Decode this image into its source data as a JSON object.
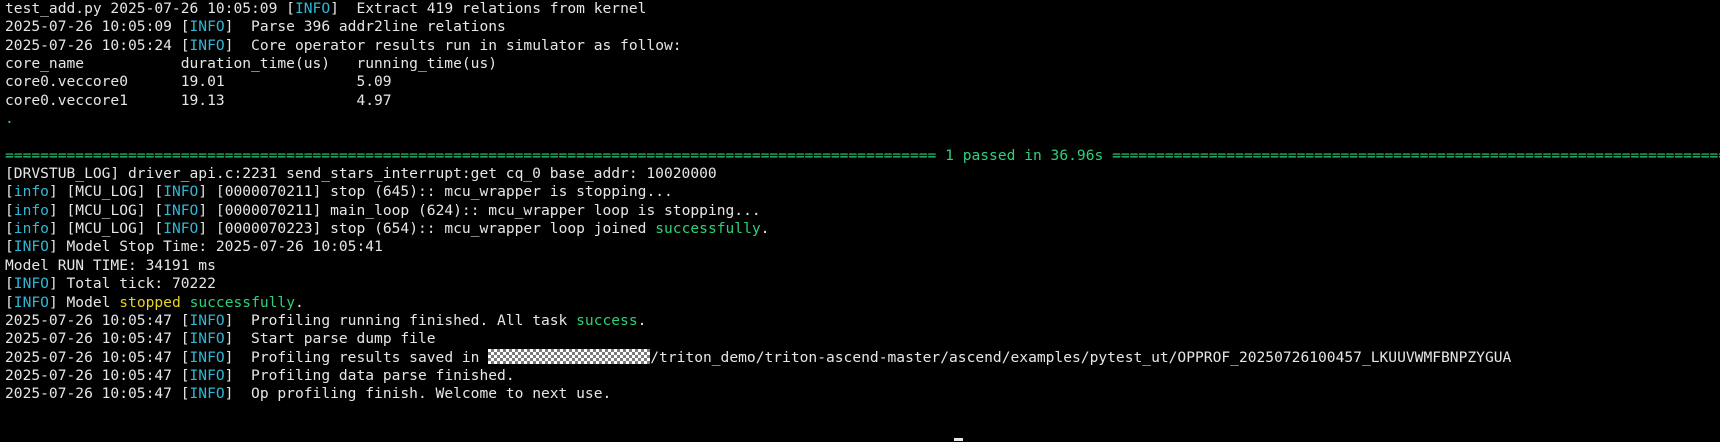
{
  "terminal": {
    "lines": [
      [
        {
          "t": "test_add.py 2025-07-26 10:05:09 "
        },
        {
          "t": "[",
          "c": ""
        },
        {
          "t": "INFO",
          "c": "info"
        },
        {
          "t": "]  Extract 419 relations from kernel"
        }
      ],
      [
        {
          "t": "2025-07-26 10:05:09 ["
        },
        {
          "t": "INFO",
          "c": "info"
        },
        {
          "t": "]  Parse 396 addr2line relations"
        }
      ],
      [
        {
          "t": "2025-07-26 10:05:24 ["
        },
        {
          "t": "INFO",
          "c": "info"
        },
        {
          "t": "]  Core operator results run in simulator as follow:"
        }
      ],
      [
        {
          "t": "core_name           duration_time(us)   running_time(us)"
        }
      ],
      [
        {
          "t": "core0.veccore0      19.01               5.09"
        }
      ],
      [
        {
          "t": "core0.veccore1      19.13               4.97"
        }
      ],
      [
        {
          "t": ".",
          "c": "green"
        }
      ],
      [
        {
          "t": ""
        }
      ],
      [
        {
          "t": "========================================================================================================== ",
          "c": "sep"
        },
        {
          "t": "1 passed in 36.96s",
          "c": "green"
        },
        {
          "t": " ===============================================================================================",
          "c": "sep"
        }
      ],
      [
        {
          "t": "[DRVSTUB_LOG] driver_api.c:2231 send_stars_interrupt:get cq_0 base_addr: 10020000"
        }
      ],
      [
        {
          "t": "["
        },
        {
          "t": "info",
          "c": "info"
        },
        {
          "t": "] [MCU_LOG] ["
        },
        {
          "t": "INFO",
          "c": "info"
        },
        {
          "t": "] [0000070211] stop (645):: mcu_wrapper is stopping..."
        }
      ],
      [
        {
          "t": "["
        },
        {
          "t": "info",
          "c": "info"
        },
        {
          "t": "] [MCU_LOG] ["
        },
        {
          "t": "INFO",
          "c": "info"
        },
        {
          "t": "] [0000070211] main_loop (624):: mcu_wrapper loop is stopping..."
        }
      ],
      [
        {
          "t": "["
        },
        {
          "t": "info",
          "c": "info"
        },
        {
          "t": "] [MCU_LOG] ["
        },
        {
          "t": "INFO",
          "c": "info"
        },
        {
          "t": "] [0000070223] stop (654):: mcu_wrapper loop joined "
        },
        {
          "t": "successfully",
          "c": "green"
        },
        {
          "t": "."
        }
      ],
      [
        {
          "t": "["
        },
        {
          "t": "INFO",
          "c": "info"
        },
        {
          "t": "] Model Stop Time: 2025-07-26 10:05:41"
        }
      ],
      [
        {
          "t": "Model RUN TIME: 34191 ms"
        }
      ],
      [
        {
          "t": "["
        },
        {
          "t": "INFO",
          "c": "info"
        },
        {
          "t": "] Total tick: 70222"
        }
      ],
      [
        {
          "t": "["
        },
        {
          "t": "INFO",
          "c": "info"
        },
        {
          "t": "] Model "
        },
        {
          "t": "stopped",
          "c": "yellow"
        },
        {
          "t": " "
        },
        {
          "t": "successfully",
          "c": "green"
        },
        {
          "t": "."
        }
      ],
      [
        {
          "t": "2025-07-26 10:05:47 ["
        },
        {
          "t": "INFO",
          "c": "info"
        },
        {
          "t": "]  Profiling running finished. All task "
        },
        {
          "t": "success",
          "c": "green"
        },
        {
          "t": "."
        }
      ],
      [
        {
          "t": "2025-07-26 10:05:47 ["
        },
        {
          "t": "INFO",
          "c": "info"
        },
        {
          "t": "]  Start parse dump file"
        }
      ],
      [
        {
          "t": "2025-07-26 10:05:47 ["
        },
        {
          "t": "INFO",
          "c": "info"
        },
        {
          "t": "]  Profiling results saved in "
        },
        {
          "t": "",
          "c": "redact"
        },
        {
          "t": "/triton_demo/triton-ascend-master/ascend/examples/pytest_ut/OPPROF_20250726100457_LKUUVWMFBNPZYGUA"
        }
      ],
      [
        {
          "t": "2025-07-26 10:05:47 ["
        },
        {
          "t": "INFO",
          "c": "info"
        },
        {
          "t": "]  Profiling data parse finished."
        }
      ],
      [
        {
          "t": "2025-07-26 10:05:47 ["
        },
        {
          "t": "INFO",
          "c": "info"
        },
        {
          "t": "]  Op profiling finish. Welcome to next use."
        }
      ]
    ],
    "colors": {
      "background": "#000000",
      "text": "#e6e6e6",
      "info": "#2fb8d6",
      "green": "#2fd07a",
      "yellow": "#e8d21e"
    }
  }
}
